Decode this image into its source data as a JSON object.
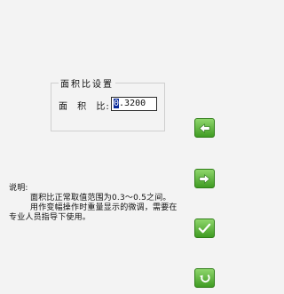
{
  "settings": {
    "group_title": "面积比设置",
    "field_label": "面 积 比:",
    "value_cursor_char": "0",
    "value_rest": ".3200"
  },
  "note": {
    "title": "说明:",
    "line1": "面积比正常取值范围为0.3～0.5之间。",
    "line2": "用作变幅操作时重量显示的微调，需要在专业人员指导下使用。"
  },
  "buttons": {
    "back_icon": "arrow-left-icon",
    "next_icon": "arrow-right-icon",
    "confirm_icon": "check-icon",
    "return_icon": "return-icon"
  },
  "colors": {
    "button_green": "#5cb83a",
    "cursor_blue": "#0a2a9a",
    "background": "#f3f3f3"
  }
}
